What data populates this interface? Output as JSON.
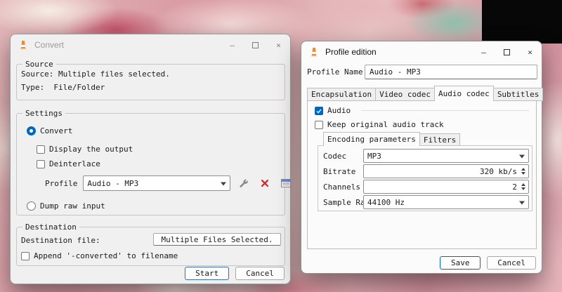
{
  "icons": {
    "minimize": "—",
    "close": "×"
  },
  "colors": {
    "accent": "#0067c0",
    "danger": "#d02b2b",
    "vlc_cone": "#f78822"
  },
  "convert_dialog": {
    "title": "Convert",
    "source_group": {
      "label": "Source",
      "source_line": "Source: Multiple files selected.",
      "type_line": "Type:  File/Folder"
    },
    "settings_group": {
      "label": "Settings",
      "convert_option": "Convert",
      "display_output_option": "Display the output",
      "deinterlace_option": "Deinterlace",
      "profile_label": "Profile",
      "profile_value": "Audio - MP3",
      "dump_raw_option": "Dump raw input"
    },
    "destination_group": {
      "label": "Destination",
      "destination_file_label": "Destination file:",
      "destination_file_value": "Multiple Files Selected.",
      "append_option": "Append '-converted' to filename"
    },
    "buttons": {
      "start": "Start",
      "cancel": "Cancel"
    }
  },
  "profile_dialog": {
    "title": "Profile edition",
    "profile_name_label": "Profile Name",
    "profile_name_value": "Audio - MP3",
    "tabs": [
      {
        "label": "Encapsulation"
      },
      {
        "label": "Video codec"
      },
      {
        "label": "Audio codec"
      },
      {
        "label": "Subtitles"
      }
    ],
    "active_tab": "Audio codec",
    "audio_option": "Audio",
    "keep_original_option": "Keep original audio track",
    "inner_tabs": [
      {
        "label": "Encoding parameters"
      },
      {
        "label": "Filters"
      }
    ],
    "active_inner_tab": "Encoding parameters",
    "form": {
      "codec_label": "Codec",
      "codec_value": "MP3",
      "bitrate_label": "Bitrate",
      "bitrate_value": "320 kb/s",
      "channels_label": "Channels",
      "channels_value": "2",
      "samplerate_label": "Sample Rate",
      "samplerate_value": "44100 Hz"
    },
    "buttons": {
      "save": "Save",
      "cancel": "Cancel"
    }
  }
}
